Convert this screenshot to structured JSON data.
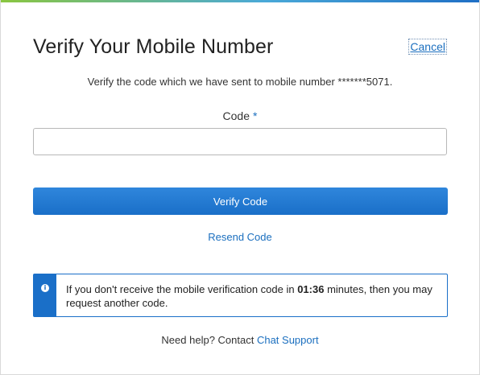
{
  "header": {
    "title": "Verify Your Mobile Number",
    "cancel_label": "Cancel"
  },
  "subtitle": "Verify the code which we have sent to mobile number *******5071.",
  "form": {
    "code_label": "Code",
    "required_marker": "*",
    "code_value": "",
    "code_placeholder": ""
  },
  "actions": {
    "verify_label": "Verify Code",
    "resend_label": "Resend Code"
  },
  "info": {
    "icon": "info-icon",
    "icon_glyph": "i",
    "text_before": "If you don't receive the mobile verification code in ",
    "countdown": "01:36",
    "text_after": " minutes, then you may request another code."
  },
  "help": {
    "prefix": "Need help? Contact ",
    "link_label": "Chat Support"
  },
  "colors": {
    "accent": "#1a6fc8",
    "link": "#1b6fbf",
    "top_gradient_start": "#8ac640",
    "top_gradient_end": "#1f6fc5"
  }
}
